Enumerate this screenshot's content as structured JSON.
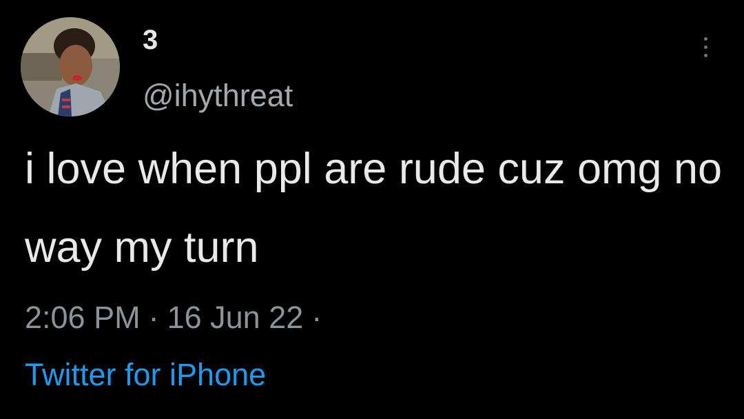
{
  "tweet": {
    "display_name": "3",
    "handle": "@ihythreat",
    "text": "i love when ppl are rude cuz omg no way my turn",
    "time": "2:06 PM",
    "date": "16 Jun 22",
    "separator": "·",
    "source": "Twitter for iPhone"
  },
  "icons": {
    "more": "more-options-icon",
    "avatar": "profile-avatar"
  },
  "colors": {
    "background": "#000000",
    "primary_text": "#e7e9ea",
    "secondary_text": "#8b939b",
    "link": "#1d9bf0"
  }
}
